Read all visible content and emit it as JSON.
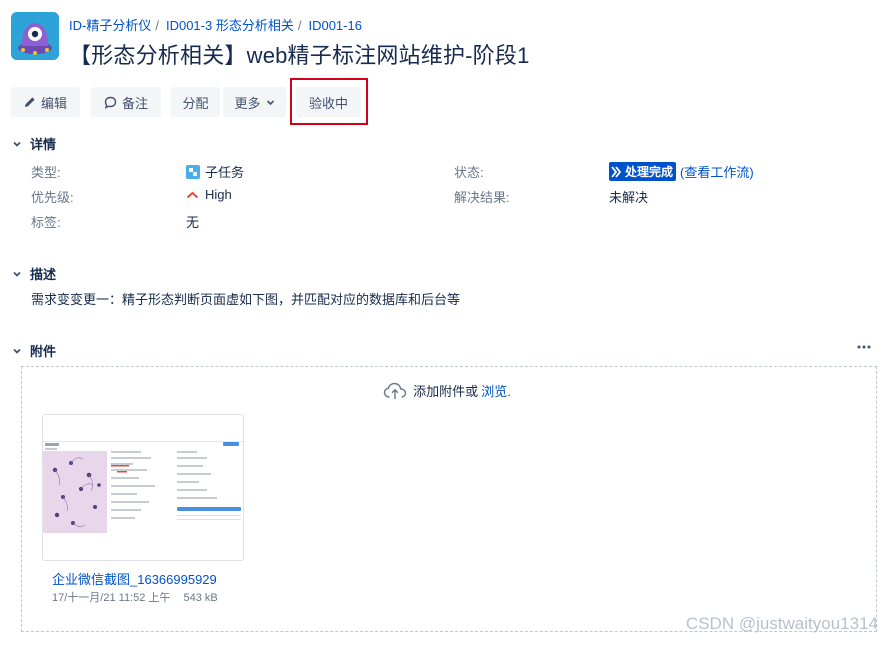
{
  "breadcrumb": [
    "ID-精子分析仪",
    "ID001-3 形态分析相关",
    "ID001-16"
  ],
  "title": "【形态分析相关】web精子标注网站维护-阶段1",
  "toolbar": {
    "edit": "编辑",
    "comment": "备注",
    "assign": "分配",
    "more": "更多",
    "accept": "验收中"
  },
  "details": {
    "heading": "详情",
    "type_label": "类型:",
    "type_value": "子任务",
    "priority_label": "优先级:",
    "priority_value": "High",
    "labels_label": "标签:",
    "labels_value": "无",
    "status_label": "状态:",
    "status_value": "处理完成",
    "workflow_link": "(查看工作流)",
    "resolution_label": "解决结果:",
    "resolution_value": "未解决"
  },
  "description": {
    "heading": "描述",
    "text": "需求变变更一：精子形态判断页面虚如下图，并匹配对应的数据库和后台等"
  },
  "attachments": {
    "heading": "附件",
    "drop_text": "添加附件或",
    "browse": "浏览.",
    "file_name": "企业微信截图_16366995929",
    "file_date": "17/十一月/21 11:52 上午",
    "file_size": "543 kB"
  },
  "watermark": "CSDN @justwaityou1314",
  "colors": {
    "link": "#0052cc",
    "status": "#0052cc",
    "priority_high": "#e5493a",
    "highlight": "#d0021b"
  }
}
